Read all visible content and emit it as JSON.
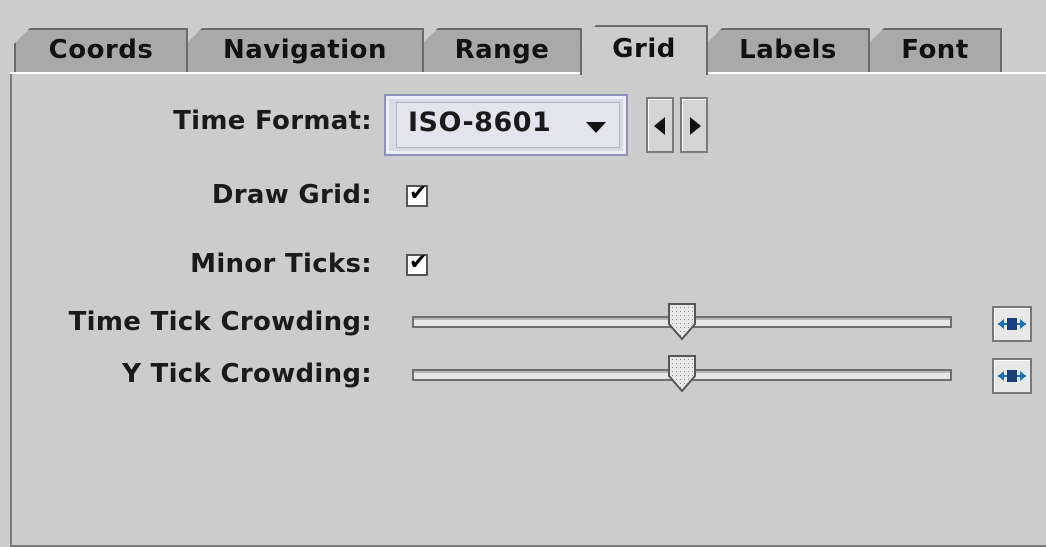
{
  "tabs": [
    {
      "label": "Coords",
      "selected": false
    },
    {
      "label": "Navigation",
      "selected": false
    },
    {
      "label": "Range",
      "selected": false
    },
    {
      "label": "Grid",
      "selected": true
    },
    {
      "label": "Labels",
      "selected": false
    },
    {
      "label": "Font",
      "selected": false
    }
  ],
  "form": {
    "time_format": {
      "label": "Time Format:",
      "value": "ISO-8601"
    },
    "draw_grid": {
      "label": "Draw Grid:",
      "checked": true,
      "mark": "✔"
    },
    "minor_ticks": {
      "label": "Minor Ticks:",
      "checked": true,
      "mark": "✔"
    },
    "time_tick_crowding": {
      "label": "Time Tick Crowding:",
      "value_fraction": 0.5
    },
    "y_tick_crowding": {
      "label": "Y Tick Crowding:",
      "value_fraction": 0.5
    }
  },
  "icons": {
    "dropdown_arrow": "chevron-down-icon",
    "prev": "arrow-left-icon",
    "next": "arrow-right-icon",
    "reset": "reset-slider-icon"
  },
  "colors": {
    "background": "#cccccc",
    "tab_inactive": "#a9a9a9",
    "combo_border": "#8f8fbf",
    "reset_icon": "#1a6fb0"
  }
}
